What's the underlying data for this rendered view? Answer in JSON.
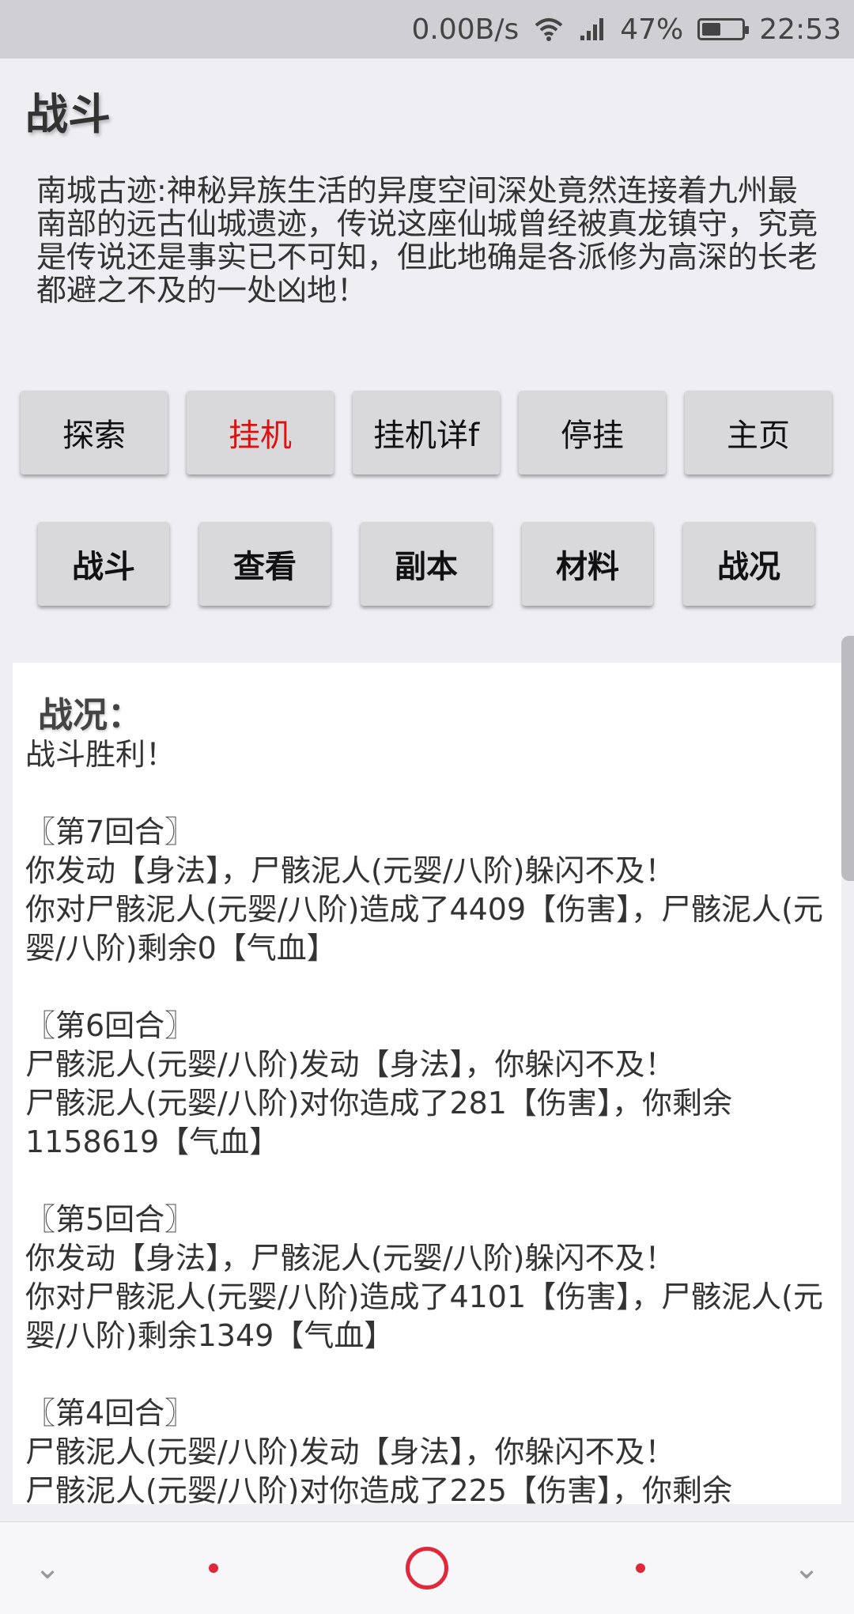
{
  "status_bar": {
    "network_speed": "0.00B/s",
    "battery_percent": "47%",
    "battery_level": 0.47,
    "time": "22:53",
    "icons": [
      "wifi-icon",
      "signal-icon",
      "battery-icon"
    ]
  },
  "header": {
    "title": "战斗"
  },
  "location": {
    "description": "南城古迹:神秘异族生活的异度空间深处竟然连接着九州最南部的远古仙城遗迹，传说这座仙城曾经被真龙镇守，究竟是传说还是事实已不可知，但此地确是各派修为高深的长老都避之不及的一处凶地！"
  },
  "actions_row1": [
    {
      "label": "探索",
      "active": false
    },
    {
      "label": "挂机",
      "active": true
    },
    {
      "label": "挂机详f",
      "active": false
    },
    {
      "label": "停挂",
      "active": false
    },
    {
      "label": "主页",
      "active": false
    }
  ],
  "actions_row2": [
    {
      "label": "战斗"
    },
    {
      "label": "查看"
    },
    {
      "label": "副本"
    },
    {
      "label": "材料"
    },
    {
      "label": "战况"
    }
  ],
  "battle_log": {
    "title": "战况：",
    "text": "战斗胜利！\n\n〖第7回合〗\n你发动【身法】，尸骸泥人(元婴/八阶)躲闪不及！\n你对尸骸泥人(元婴/八阶)造成了4409【伤害】，尸骸泥人(元婴/八阶)剩余0【气血】\n\n〖第6回合〗\n尸骸泥人(元婴/八阶)发动【身法】，你躲闪不及！\n尸骸泥人(元婴/八阶)对你造成了281【伤害】，你剩余1158619【气血】\n\n〖第5回合〗\n你发动【身法】，尸骸泥人(元婴/八阶)躲闪不及！\n你对尸骸泥人(元婴/八阶)造成了4101【伤害】，尸骸泥人(元婴/八阶)剩余1349【气血】\n\n〖第4回合〗\n尸骸泥人(元婴/八阶)发动【身法】，你躲闪不及！\n尸骸泥人(元婴/八阶)对你造成了225【伤害】，你剩余"
  },
  "colors": {
    "active_button_text": "#e01010",
    "nav_accent": "#e0283a"
  }
}
